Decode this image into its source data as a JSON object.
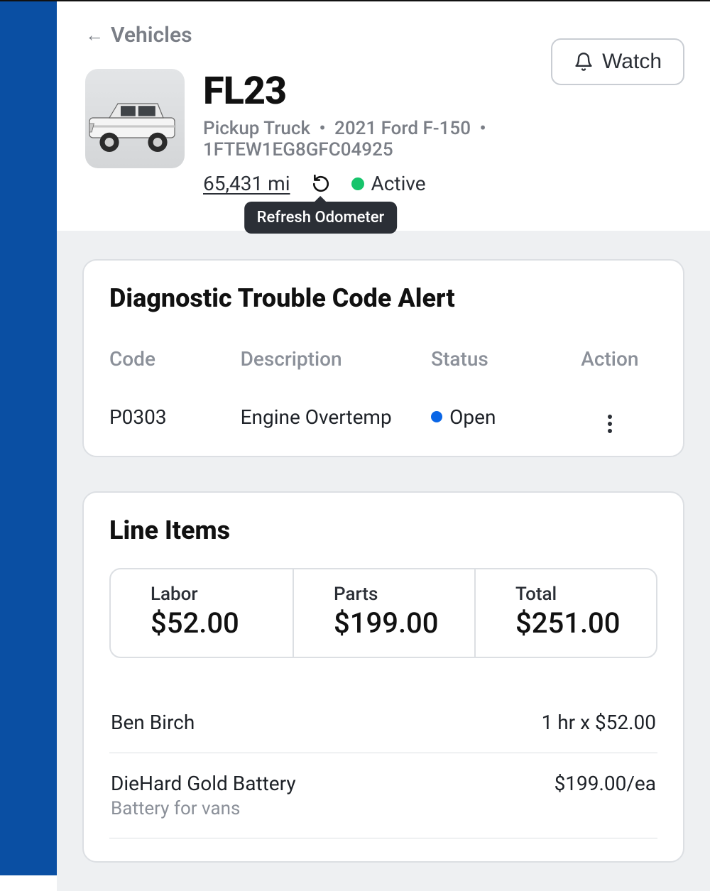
{
  "breadcrumb": {
    "label": "Vehicles"
  },
  "watch": {
    "label": "Watch"
  },
  "vehicle": {
    "name": "FL23",
    "type": "Pickup Truck",
    "model": "2021 Ford F-150",
    "vin": "1FTEW1EG8GFC04925",
    "odometer": "65,431 mi",
    "refresh_tooltip": "Refresh Odometer",
    "status_label": "Active"
  },
  "dtc": {
    "title": "Diagnostic Trouble Code Alert",
    "headers": {
      "code": "Code",
      "description": "Description",
      "status": "Status",
      "action": "Action"
    },
    "row": {
      "code": "P0303",
      "description": "Engine Overtemp",
      "status": "Open"
    }
  },
  "line_items": {
    "title": "Line Items",
    "totals": {
      "labor_label": "Labor",
      "labor_value": "$52.00",
      "parts_label": "Parts",
      "parts_value": "$199.00",
      "total_label": "Total",
      "total_value": "$251.00"
    },
    "rows": [
      {
        "name": "Ben Birch",
        "desc": "",
        "right": "1 hr x $52.00"
      },
      {
        "name": "DieHard Gold Battery",
        "desc": "Battery for vans",
        "right": "$199.00/ea"
      }
    ]
  }
}
